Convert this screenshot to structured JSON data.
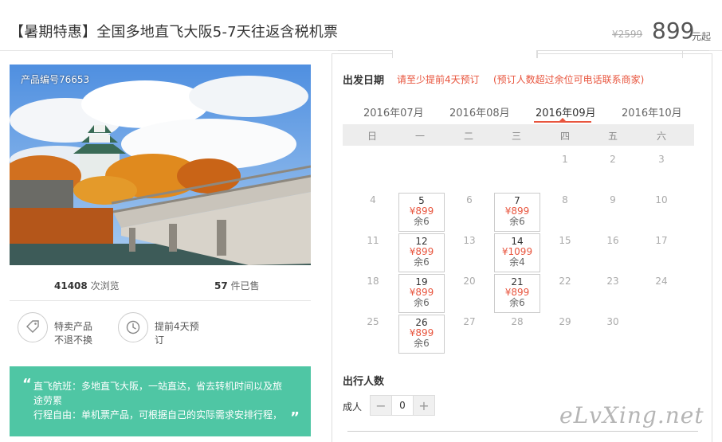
{
  "header": {
    "title": "【暑期特惠】全国多地直飞大阪5-7天往返含税机票",
    "original_price": "¥2599",
    "price": "899",
    "price_unit": "元起"
  },
  "photo": {
    "product_number": "产品编号76653"
  },
  "stats": {
    "views_count": "41408",
    "views_label": "次浏览",
    "sold_count": "57",
    "sold_label": "件已售"
  },
  "features": [
    {
      "icon": "tag-icon",
      "line1": "特卖产品",
      "line2": "不退不换"
    },
    {
      "icon": "clock-icon",
      "line1": "提前4天预",
      "line2": "订"
    }
  ],
  "highlights": {
    "line1": "直飞航班：多地直飞大阪，一站直达，省去转机时间以及旅",
    "line2": "途劳累",
    "line3": "行程自由：单机票产品，可根据自己的实际需求安排行程，",
    "open_quote": "“",
    "close_quote": "”",
    "color": "#4fc6a4"
  },
  "booking": {
    "depart_label": "出发日期",
    "notice_advance": "请至少提前4天预订",
    "notice_contact": "(预订人数超过余位可电话联系商家)",
    "months": [
      "2016年07月",
      "2016年08月",
      "2016年09月",
      "2016年10月"
    ],
    "active_month": "2016年09月",
    "weekdays": [
      "日",
      "一",
      "二",
      "三",
      "四",
      "五",
      "六"
    ],
    "travelers_label": "出行人数",
    "adult_label": "成人",
    "adult_count": "0",
    "minus": "−",
    "plus": "+",
    "accent_color": "#e8553e"
  },
  "calendar": {
    "plain_days": [
      "1",
      "2",
      "3",
      "4",
      "6",
      "8",
      "9",
      "10",
      "11",
      "13",
      "15",
      "16",
      "17",
      "18",
      "20",
      "22",
      "23",
      "24",
      "25",
      "27",
      "28",
      "29",
      "30"
    ],
    "available": [
      {
        "day": "5",
        "price": "¥899",
        "left": "余6"
      },
      {
        "day": "7",
        "price": "¥899",
        "left": "余6"
      },
      {
        "day": "12",
        "price": "¥899",
        "left": "余6"
      },
      {
        "day": "14",
        "price": "¥1099",
        "left": "余4"
      },
      {
        "day": "19",
        "price": "¥899",
        "left": "余6"
      },
      {
        "day": "21",
        "price": "¥899",
        "left": "余6"
      },
      {
        "day": "26",
        "price": "¥899",
        "left": "余6"
      }
    ]
  },
  "watermark": "eLvXing.net"
}
